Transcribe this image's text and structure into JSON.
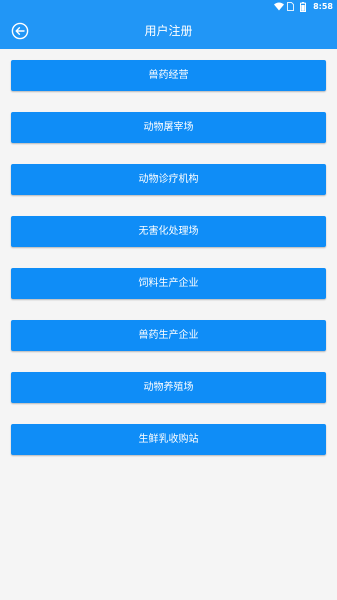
{
  "status_bar": {
    "time": "8:58",
    "icons": [
      "wifi-icon",
      "sim-icon",
      "battery-icon"
    ]
  },
  "header": {
    "title": "用户注册",
    "back_icon": "back-arrow-circle-icon",
    "background": "#2196f6"
  },
  "registration_types": [
    {
      "label": "兽药经营"
    },
    {
      "label": "动物屠宰场"
    },
    {
      "label": "动物诊疗机构"
    },
    {
      "label": "无害化处理场"
    },
    {
      "label": "饲料生产企业"
    },
    {
      "label": "兽药生产企业"
    },
    {
      "label": "动物养殖场"
    },
    {
      "label": "生鲜乳收购站"
    }
  ],
  "colors": {
    "button_background": "#0f8df7",
    "button_text": "#ffffff",
    "page_background": "#f5f5f5"
  }
}
